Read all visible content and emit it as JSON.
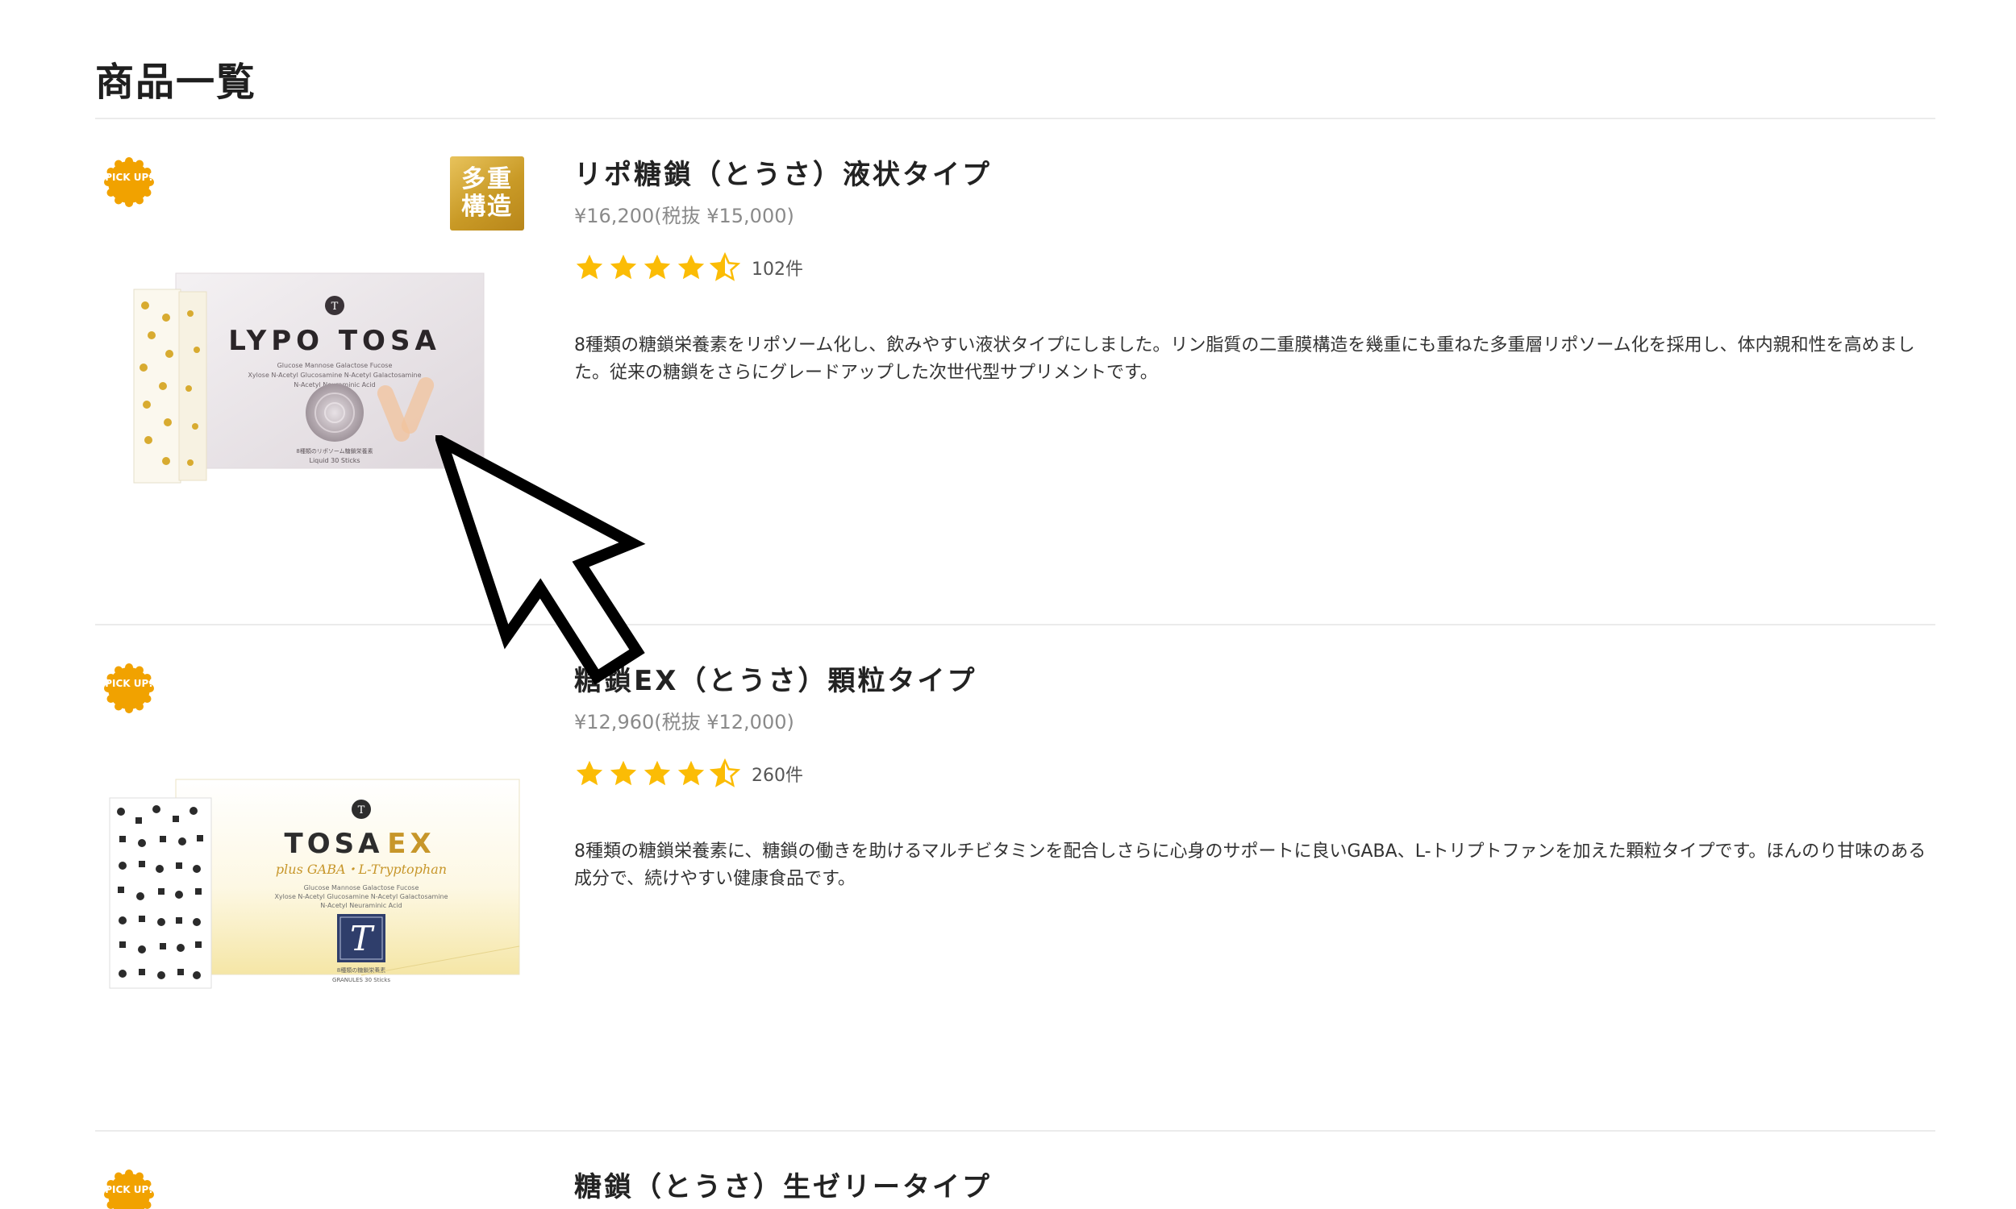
{
  "page": {
    "title": "商品一覧"
  },
  "colors": {
    "star": "#fbbc05",
    "pickup": "#f1a200",
    "gold": "#c99a26",
    "price": "#8a8a8a",
    "divider": "#ebebeb"
  },
  "products": [
    {
      "name": "リポ糖鎖（とうさ）液状タイプ",
      "price": "¥16,200(税抜 ¥15,000)",
      "rating": 4.5,
      "review_count": "102件",
      "description": "8種類の糖鎖栄養素をリポソーム化し、飲みやすい液状タイプにしました。リン脂質の二重膜構造を幾重にも重ねた多重層リポソーム化を採用し、体内親和性を高めました。従来の糖鎖をさらにグレードアップした次世代型サプリメントです。",
      "badge_pickup": "PICK UP!",
      "badge_feature": [
        "多重",
        "構造"
      ],
      "package": {
        "brand": "LYPO TOSA",
        "ingredients_1": "Glucose Mannose Galactose Fucose",
        "ingredients_2": "Xylose N-Acetyl Glucosamine N-Acetyl Galactosamine",
        "ingredients_3": "N-Acetyl Neuraminic Acid",
        "caption": "8種類のリポソーム糖鎖栄養素",
        "volume": "Liquid 30 Sticks"
      }
    },
    {
      "name": "糖鎖EX（とうさ）顆粒タイプ",
      "price": "¥12,960(税抜 ¥12,000)",
      "rating": 4.5,
      "review_count": "260件",
      "description": "8種類の糖鎖栄養素に、糖鎖の働きを助けるマルチビタミンを配合しさらに心身のサポートに良いGABA、L-トリプトファンを加えた顆粒タイプです。ほんのり甘味のある成分で、続けやすい健康食品です。",
      "badge_pickup": "PICK UP!",
      "package": {
        "brand_a": "TOSA",
        "brand_b": "EX",
        "subtitle": "plus GABA・L-Tryptophan",
        "ingredients_1": "Glucose Mannose Galactose Fucose",
        "ingredients_2": "Xylose N-Acetyl Glucosamine N-Acetyl Galactosamine",
        "ingredients_3": "N-Acetyl Neuraminic Acid",
        "emblem": "T",
        "caption": "8種類の糖鎖栄養素",
        "volume": "GRANULES 30 Sticks"
      }
    },
    {
      "name": "糖鎖（とうさ）生ゼリータイプ",
      "badge_pickup": "PICK UP!"
    }
  ]
}
